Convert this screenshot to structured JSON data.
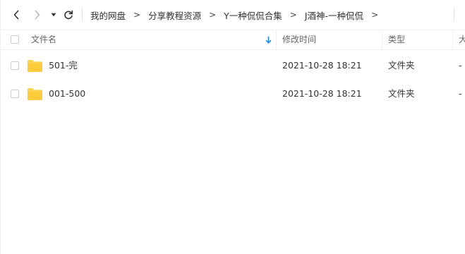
{
  "toolbar": {
    "back_icon": "chevron-left-icon",
    "forward_icon": "chevron-right-icon",
    "dropdown_icon": "caret-down-icon",
    "refresh_icon": "refresh-icon"
  },
  "breadcrumb": {
    "items": [
      "我的网盘",
      "分享教程资源",
      "Y一种侃侃合集",
      "J酒神-一种侃侃"
    ],
    "separator": ">"
  },
  "columns": {
    "name": "文件名",
    "modified": "修改时间",
    "type": "类型",
    "size": "大"
  },
  "sort_icon": "sort-arrow-down-icon",
  "accent_color": "#1a8cff",
  "folder_color": "#ffd24d",
  "files": [
    {
      "name": "501-完",
      "modified": "2021-10-28 18:21",
      "type": "文件夹",
      "size": "-"
    },
    {
      "name": "001-500",
      "modified": "2021-10-28 18:21",
      "type": "文件夹",
      "size": "-"
    }
  ]
}
